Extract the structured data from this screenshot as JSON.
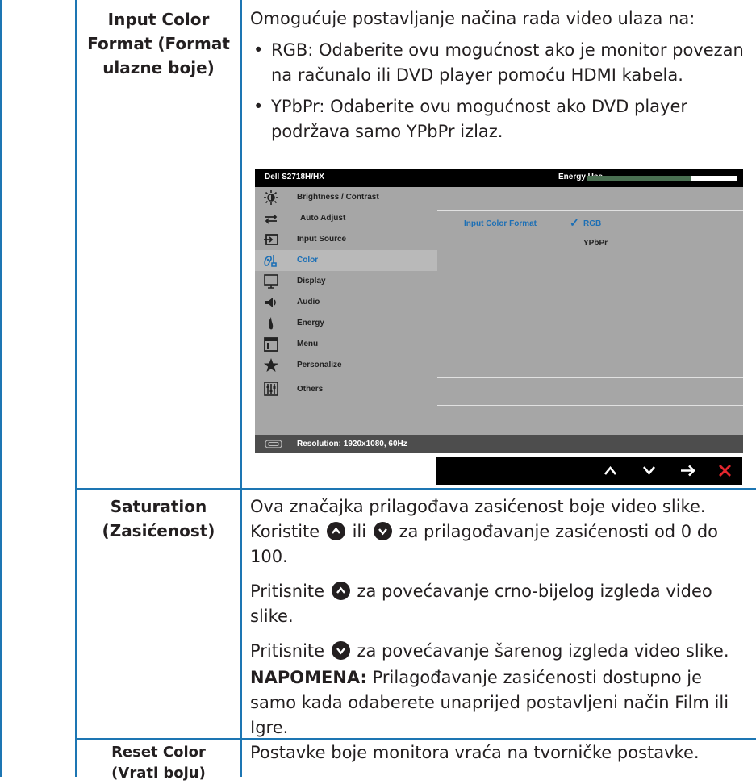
{
  "rows": [
    {
      "name_lines": [
        "Input Color",
        "Format (Format",
        "ulazne boje)"
      ],
      "intro": "Omogućuje postavljanje načina rada video ulaza na:",
      "bullets": [
        "RGB: Odaberite ovu mogućnost ako je monitor povezan na računalo ili DVD player pomoću HDMI kabela.",
        "YPbPr: Odaberite ovu mogućnost ako DVD player podržava samo YPbPr izlaz."
      ]
    },
    {
      "name_lines": [
        "Saturation",
        "(Zasićenost)"
      ],
      "p1_before": "Ova značajka prilagođava zasićenost boje video slike. Koristite",
      "p1_mid": "ili",
      "p1_after": "za prilagođavanje zasićenosti od 0 do 100.",
      "p2_before": "Pritisnite",
      "p2_after": "za povećavanje crno-bijelog izgleda video slike.",
      "p3_before": "Pritisnite",
      "p3_after": "za povećavanje šarenog izgleda video slike.",
      "note_label": "NAPOMENA:",
      "note_text": "Prilagođavanje zasićenosti dostupno je samo kada odaberete unaprijed postavljeni način Film ili Igre."
    },
    {
      "name_lines": [
        "Reset Color",
        "(Vrati boju)"
      ],
      "desc": "Postavke boje monitora vraća na tvorničke postavke."
    }
  ],
  "osd": {
    "title": "Dell S2718H/HX",
    "energy_label": "Energy Use",
    "energy_level": 0.7,
    "menu": [
      {
        "label": "Brightness / Contrast",
        "icon": "brightness-icon"
      },
      {
        "label": "Auto Adjust",
        "icon": "auto-adjust-icon"
      },
      {
        "label": "Input Source",
        "icon": "input-source-icon"
      },
      {
        "label": "Color",
        "icon": "color-icon",
        "selected": true
      },
      {
        "label": "Display",
        "icon": "display-icon"
      },
      {
        "label": "Audio",
        "icon": "audio-icon"
      },
      {
        "label": "Energy",
        "icon": "energy-icon"
      },
      {
        "label": "Menu",
        "icon": "menu-icon"
      },
      {
        "label": "Personalize",
        "icon": "personalize-icon"
      },
      {
        "label": "Others",
        "icon": "others-icon"
      }
    ],
    "setting_label": "Input Color Format",
    "options": [
      "RGB",
      "YPbPr"
    ],
    "selected_option": "RGB",
    "resolution": "Resolution: 1920x1080, 60Hz",
    "nav_buttons": [
      "up-icon",
      "down-icon",
      "right-arrow-icon",
      "close-icon"
    ]
  },
  "colors": {
    "rule": "#1d76b3",
    "text": "#231f20",
    "osd_selected": "#1c6fb5",
    "energy_fill": "#4a6f51",
    "close": "#e3262e"
  }
}
